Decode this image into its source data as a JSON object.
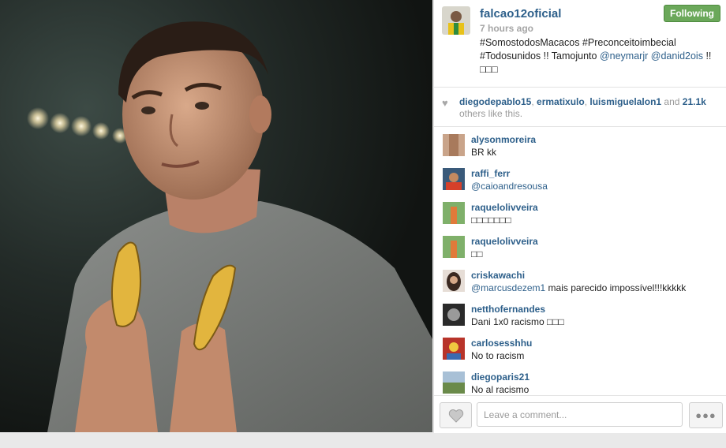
{
  "post": {
    "username": "falcao12oficial",
    "time_ago": "7 hours ago",
    "follow_label": "Following",
    "caption": {
      "text1": "#SomostodosMacacos #Preconceitoimbecial #Todosunidos !! Tamojunto ",
      "mention1": "@neymarjr",
      "sep": " ",
      "mention2": "@danid2ois",
      "text2": " !! ",
      "emoji": "□□□"
    }
  },
  "likes": {
    "names": [
      "diegodepablo15",
      "ermatixulo",
      "luismiguelalon1"
    ],
    "and_text": " and ",
    "count": "21.1k",
    "suffix": " others like this."
  },
  "comments": [
    {
      "user": "alysonmoreira",
      "text": "BR kk",
      "mention": ""
    },
    {
      "user": "raffi_ferr",
      "text": "",
      "mention": "@caioandresousa"
    },
    {
      "user": "raquelolivveira",
      "text": "□□□□□□□",
      "mention": ""
    },
    {
      "user": "raquelolivveira",
      "text": "□□",
      "mention": ""
    },
    {
      "user": "criskawachi",
      "text": " mais parecido impossível!!!kkkkk",
      "mention": "@marcusdezem1"
    },
    {
      "user": "netthofernandes",
      "text": "Dani 1x0 racismo □□□",
      "mention": ""
    },
    {
      "user": "carlosesshhu",
      "text": "No to racism",
      "mention": ""
    },
    {
      "user": "diegoparis21",
      "text": "No al racismo",
      "mention": ""
    }
  ],
  "footer": {
    "comment_placeholder": "Leave a comment...",
    "more_label": "●●●"
  },
  "colors": {
    "link": "#2d5f8a",
    "follow_green": "#6ba85a"
  }
}
